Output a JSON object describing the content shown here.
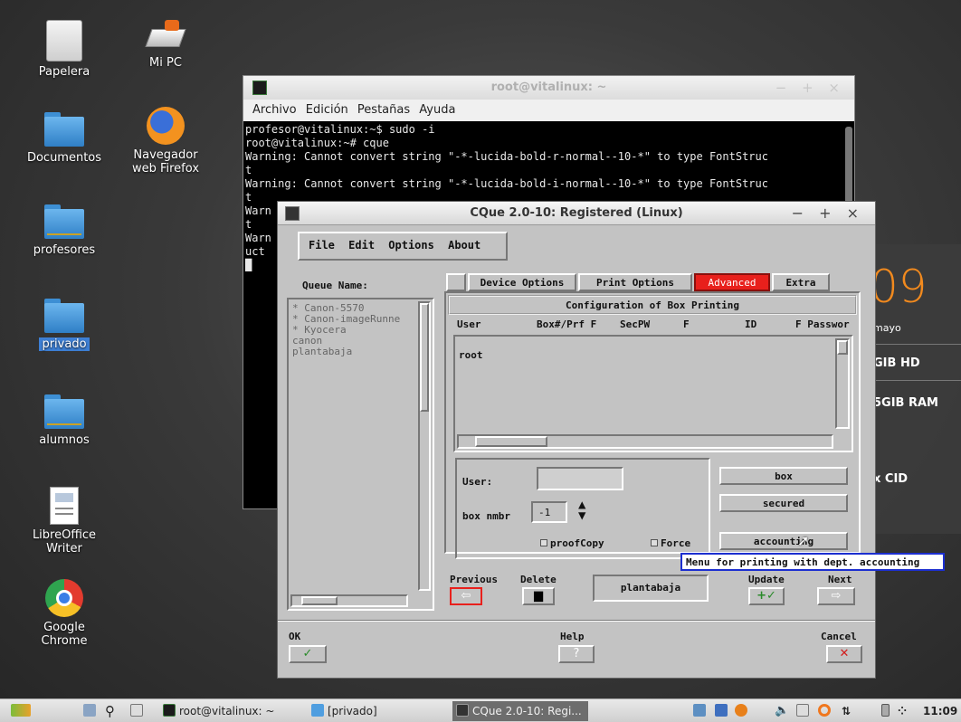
{
  "desktop": {
    "icons": [
      {
        "label": "Papelera"
      },
      {
        "label": "Mi PC"
      },
      {
        "label": "Documentos"
      },
      {
        "label": "Navegador web Firefox"
      },
      {
        "label": "profesores"
      },
      {
        "label": "privado"
      },
      {
        "label": "alumnos"
      },
      {
        "label": "LibreOffice Writer"
      },
      {
        "label": "Google Chrome"
      }
    ]
  },
  "terminal": {
    "title": "root@vitalinux: ~",
    "controls": "− + ×",
    "menu": [
      "Archivo",
      "Edición",
      "Pestañas",
      "Ayuda"
    ],
    "content": "profesor@vitalinux:~$ sudo -i\nroot@vitalinux:~# cque\nWarning: Cannot convert string \"-*-lucida-bold-r-normal--10-*\" to type FontStruc\nt\nWarning: Cannot convert string \"-*-lucida-bold-i-normal--10-*\" to type FontStruc\nt\nWarn\nt\nWarn\nuct\n█"
  },
  "widgets": {
    "clock_fragment": "09",
    "month_fragment": "mayo",
    "disk": "GIB HD",
    "ram": "5GIB  RAM",
    "cid": "x CID"
  },
  "cque": {
    "title": "CQue 2.0-10: Registered (Linux)",
    "controls": "− + ×",
    "menu": [
      "File",
      "Edit",
      "Options",
      "About"
    ],
    "queue_label": "Queue Name:",
    "queues": [
      "* Canon-5570",
      "* Canon-imageRunne",
      "* Kyocera",
      "canon",
      "plantabaja"
    ],
    "tabs": [
      "Device Options",
      "Print Options",
      "Advanced",
      "Extra"
    ],
    "section_title": "Configuration of Box Printing",
    "columns": [
      "User",
      "Box#/Prf F",
      "SecPW",
      "F",
      "ID",
      "F Passwor"
    ],
    "rows": [
      "root"
    ],
    "user_label": "User:",
    "user_value": "",
    "box_label": "box nmbr",
    "box_value": "-1",
    "proofcopy_label": "proofCopy",
    "force_label": "Force",
    "buttons": {
      "box": "box",
      "secured": "secured",
      "accounting": "accounting"
    },
    "tooltip": "Menu for printing with dept. accounting",
    "previous": "Previous",
    "delete": "Delete",
    "current_queue": "plantabaja",
    "update": "Update",
    "next": "Next",
    "ok": "OK",
    "help": "Help",
    "cancel": "Cancel"
  },
  "taskbar": {
    "items": [
      "root@vitalinux: ~",
      "[privado]",
      "CQue 2.0-10: Regi..."
    ],
    "clock": "11:09"
  },
  "colors": {
    "advanced_tab": "#e8201c",
    "tooltip_border": "#1c2fd0",
    "accent_orange": "#f28a1e"
  }
}
